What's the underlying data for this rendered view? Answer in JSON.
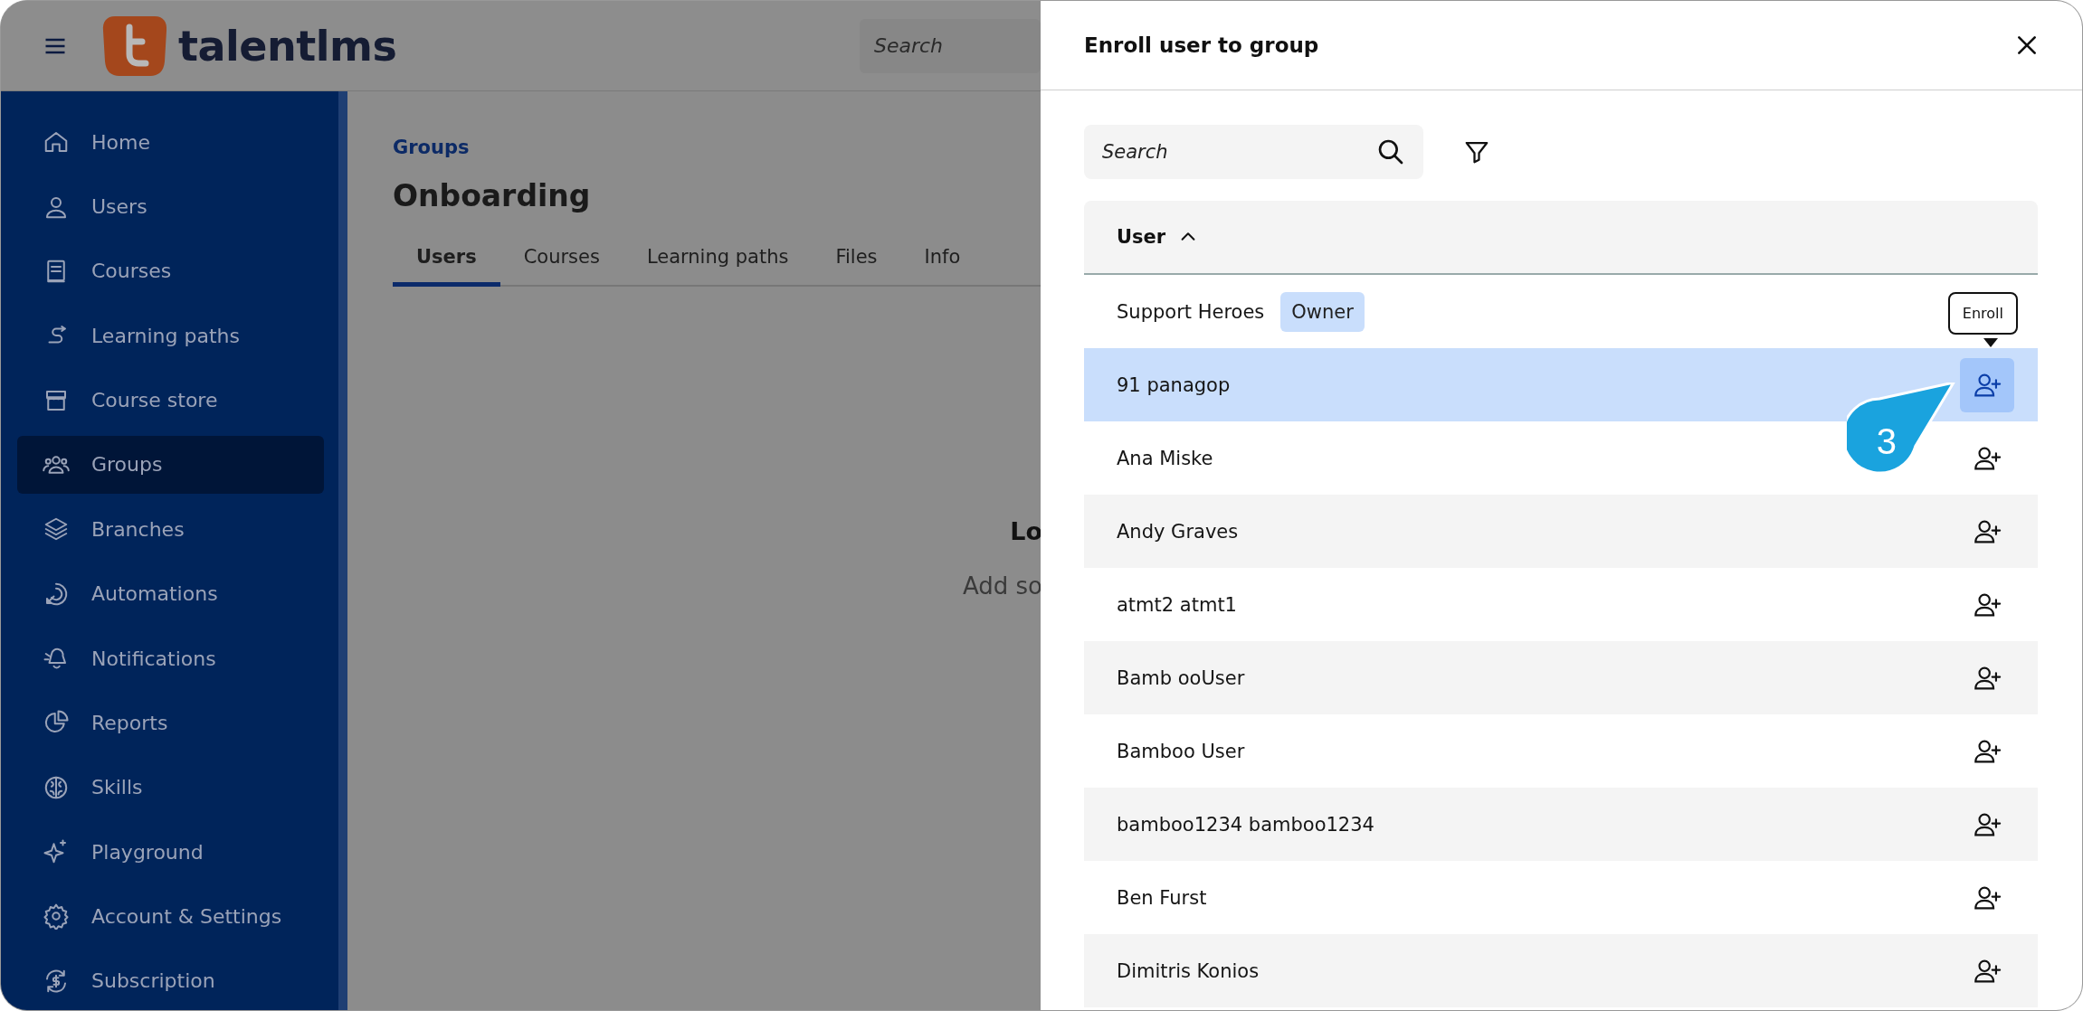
{
  "header": {
    "logo_text": "talentlms",
    "search": {
      "placeholder": "Search"
    }
  },
  "sidebar": {
    "items": [
      {
        "label": "Home",
        "selected": false
      },
      {
        "label": "Users",
        "selected": false
      },
      {
        "label": "Courses",
        "selected": false
      },
      {
        "label": "Learning paths",
        "selected": false
      },
      {
        "label": "Course store",
        "selected": false
      },
      {
        "label": "Groups",
        "selected": true
      },
      {
        "label": "Branches",
        "selected": false
      },
      {
        "label": "Automations",
        "selected": false
      },
      {
        "label": "Notifications",
        "selected": false
      },
      {
        "label": "Reports",
        "selected": false
      },
      {
        "label": "Skills",
        "selected": false
      },
      {
        "label": "Playground",
        "selected": false
      },
      {
        "label": "Account & Settings",
        "selected": false
      },
      {
        "label": "Subscription",
        "selected": false
      }
    ]
  },
  "main": {
    "breadcrumb": "Groups",
    "title": "Onboarding",
    "tabs": [
      {
        "label": "Users",
        "selected": true
      },
      {
        "label": "Courses",
        "selected": false
      },
      {
        "label": "Learning paths",
        "selected": false
      },
      {
        "label": "Files",
        "selected": false
      },
      {
        "label": "Info",
        "selected": false
      }
    ],
    "empty_title": "Lo",
    "empty_text": "Add so"
  },
  "panel": {
    "title": "Enroll user to group",
    "search": {
      "placeholder": "Search"
    },
    "table": {
      "column": "User",
      "rows": [
        {
          "kind": "owner",
          "name": "Support Heroes",
          "tag": "Owner",
          "selected": false
        },
        {
          "kind": "member",
          "name": "91 panagop",
          "selected": true
        },
        {
          "kind": "member",
          "name": "Ana Miske",
          "selected": false
        },
        {
          "kind": "member",
          "name": "Andy Graves",
          "selected": false
        },
        {
          "kind": "member",
          "name": "atmt2 atmt1",
          "selected": false
        },
        {
          "kind": "member",
          "name": "Bamb ooUser",
          "selected": false
        },
        {
          "kind": "member",
          "name": "Bamboo User",
          "selected": false
        },
        {
          "kind": "member",
          "name": "bamboo1234 bamboo1234",
          "selected": false
        },
        {
          "kind": "member",
          "name": "Ben Furst",
          "selected": false
        },
        {
          "kind": "member",
          "name": "Dimitris Konios",
          "selected": false
        }
      ]
    },
    "tooltip": "Enroll",
    "callout": "3"
  }
}
